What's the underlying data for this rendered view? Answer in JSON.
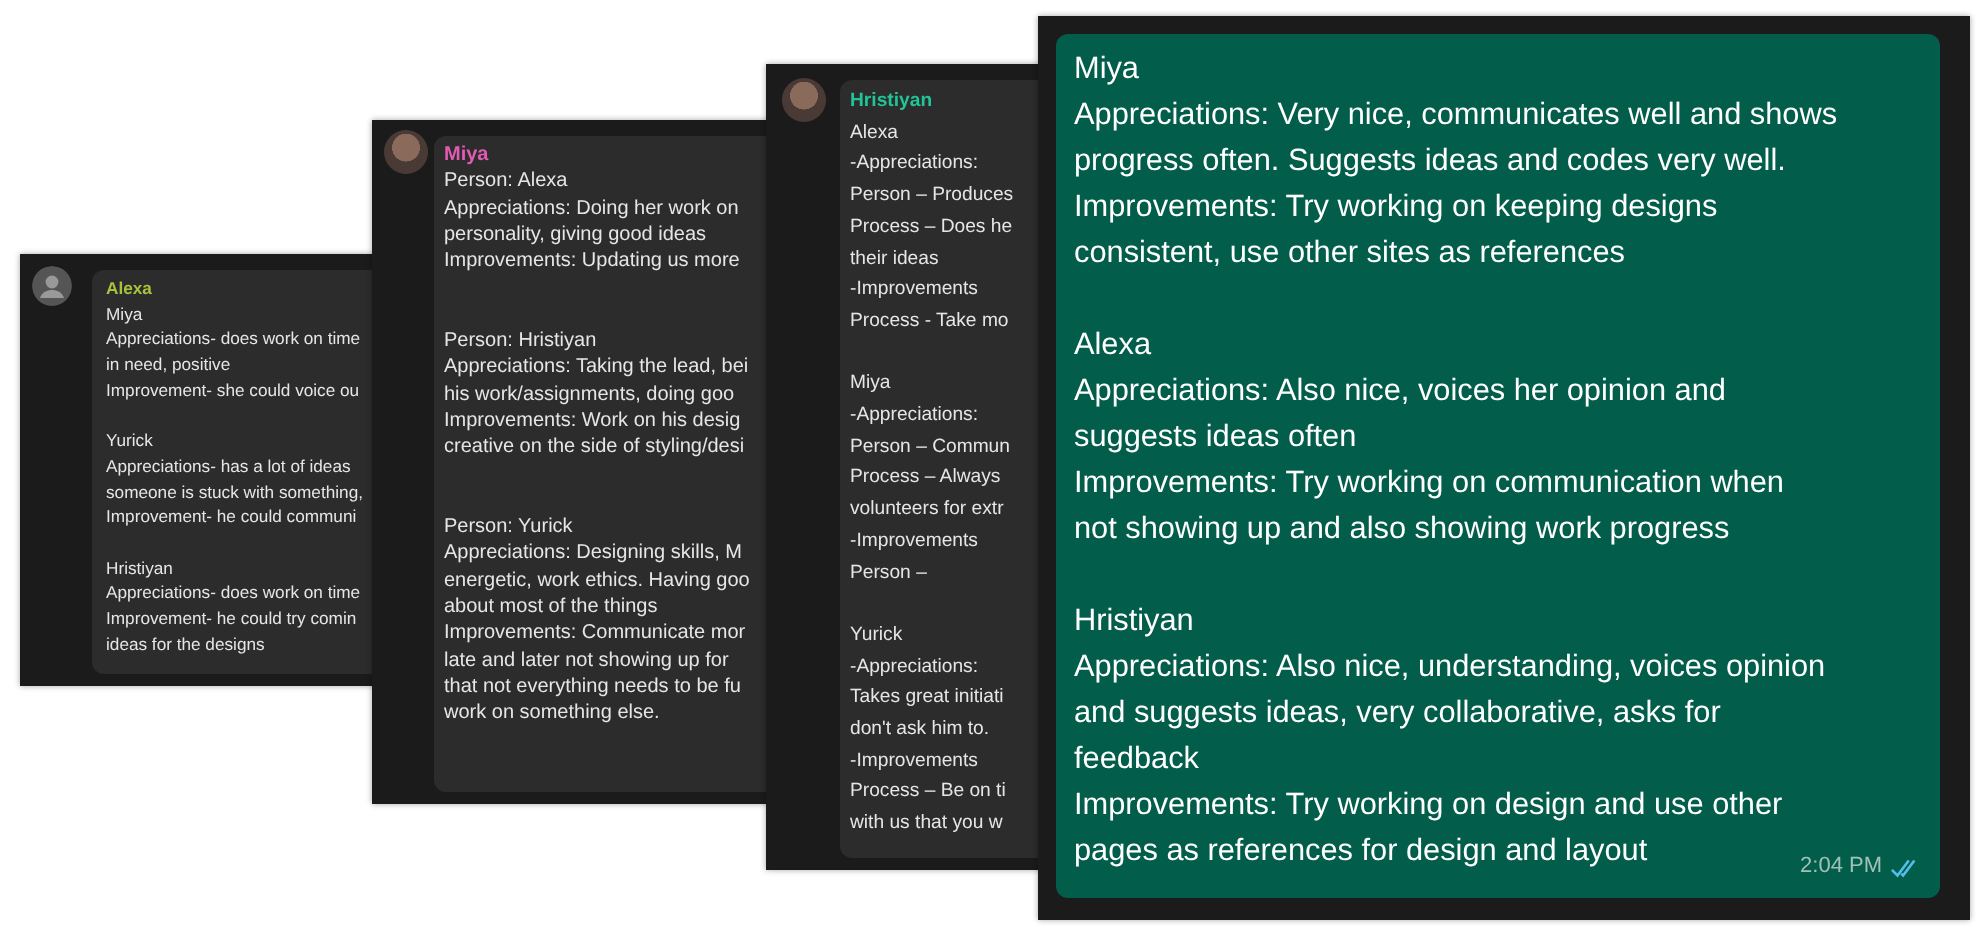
{
  "chats": [
    {
      "kind": "incoming",
      "avatar": {
        "kind": "default"
      },
      "sender": "Alexa",
      "color": "#a6c33b",
      "paragraphs": [
        [
          "Miya",
          "Appreciations- does work on time",
          "in need, positive",
          "Improvement- she could voice ou"
        ],
        [
          "Yurick",
          "Appreciations- has a lot of ideas",
          "someone is stuck with something,",
          "Improvement- he could communi"
        ],
        [
          "Hristiyan",
          "Appreciations- does work on time",
          "Improvement- he could try comin",
          "ideas for the designs"
        ]
      ]
    },
    {
      "kind": "incoming",
      "avatar": {
        "kind": "photo"
      },
      "sender": "Miya",
      "color": "#e15bb4",
      "paragraphs": [
        [
          "Person: Alexa",
          "Appreciations:  Doing her work on",
          "personality, giving good ideas",
          "Improvements: Updating us more"
        ],
        [
          "Person: Hristiyan",
          "Appreciations: Taking the lead, bei",
          "his work/assignments, doing goo",
          "Improvements: Work on his desig",
          "creative on the side of styling/desi"
        ],
        [
          "Person: Yurick",
          "Appreciations: Designing skills, M",
          "energetic, work ethics. Having goo",
          "about most of the things",
          "Improvements: Communicate mor",
          "late and later not showing up for",
          "that not everything needs to be fu",
          "work on something else."
        ]
      ]
    },
    {
      "kind": "incoming",
      "avatar": {
        "kind": "photo"
      },
      "sender": "Hristiyan",
      "color": "#21c498",
      "paragraphs": [
        [
          "Alexa",
          "-Appreciations:",
          "Person – Produces",
          "Process – Does he",
          "their ideas",
          "-Improvements",
          "Process - Take mo"
        ],
        [
          "Miya",
          "-Appreciations:",
          "Person – Commun",
          "Process – Always",
          "volunteers for extr",
          "-Improvements",
          "Person –"
        ],
        [
          "Yurick",
          "-Appreciations:",
          "Takes great initiati",
          "don't ask him to.",
          "-Improvements",
          "Process – Be on ti",
          "with us that you w"
        ]
      ]
    },
    {
      "kind": "outgoing",
      "time": "2:04 PM",
      "read": true,
      "paragraphs": [
        [
          "Miya",
          "Appreciations: Very nice, communicates well and shows",
          "progress often. Suggests ideas and codes very well.",
          "Improvements: Try working on keeping designs",
          "consistent, use other sites as references"
        ],
        [
          "Alexa",
          "Appreciations: Also nice, voices her opinion and",
          "suggests ideas often",
          "Improvements: Try working on communication when",
          "not showing up and also showing work progress"
        ],
        [
          "Hristiyan",
          "Appreciations: Also nice, understanding, voices opinion",
          "and suggests ideas, very collaborative, asks for",
          "feedback",
          "Improvements: Try working on design and use other",
          "pages as references for design and layout"
        ]
      ]
    }
  ]
}
